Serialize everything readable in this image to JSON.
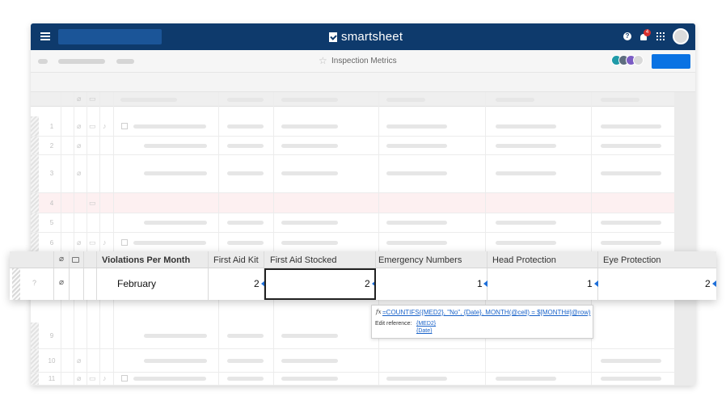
{
  "app": {
    "brand_name": "smartsheet",
    "notifications_count": "4",
    "help_glyph": "?",
    "colors": {
      "topbar": "#0e3a6c",
      "accent": "#0a73e3",
      "badge": "#d62e2e",
      "highlight_row": "#fdf0f1"
    }
  },
  "sheet": {
    "title": "Inspection Metrics",
    "row_numbers": [
      "1",
      "2",
      "3",
      "4",
      "5",
      "6",
      "9",
      "10",
      "11"
    ]
  },
  "overlay": {
    "columns": [
      "Violations Per Month",
      "First Aid Kit",
      "First Aid Stocked",
      "Emergency Numbers",
      "Head Protection",
      "Eye Protection"
    ],
    "row": {
      "number": "?",
      "name": "February",
      "values": [
        "2",
        "2",
        "1",
        "1",
        "2"
      ]
    }
  },
  "formula_tip": {
    "fx_glyph": "fx",
    "formula": "=COUNTIFS({MED2}, \"No\", {Date}, MONTH(@cell) = $[MONTH#]@row)",
    "edit_label": "Edit reference:",
    "references": [
      "{MED2}",
      "{Date}"
    ]
  },
  "icons": [
    "menu-icon",
    "help-icon",
    "bell-icon",
    "apps-icon",
    "star-icon",
    "attachment-icon",
    "comment-icon",
    "function-icon"
  ]
}
